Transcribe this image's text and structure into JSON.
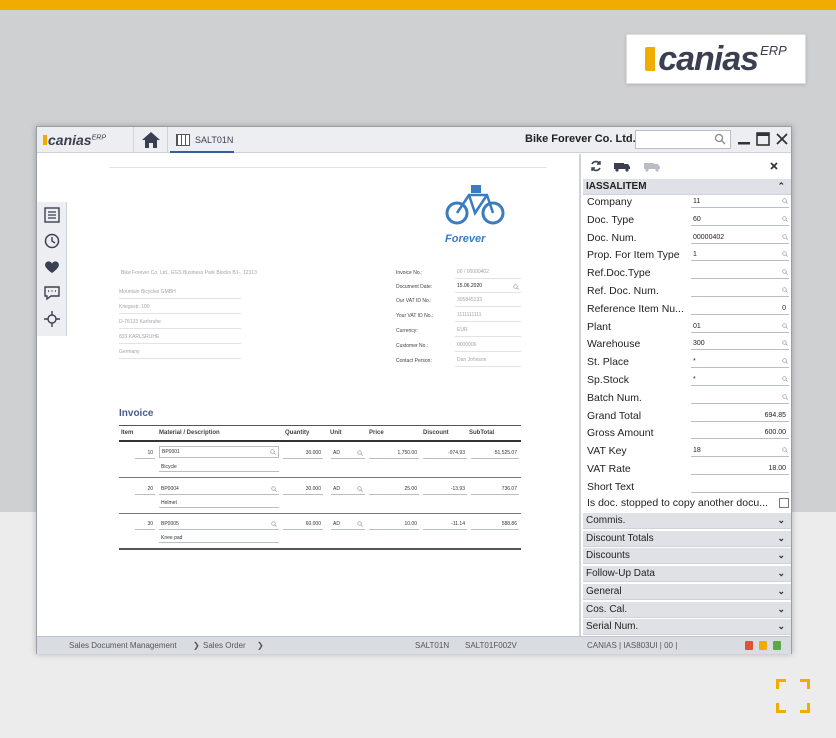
{
  "brand": {
    "name": "canias",
    "suffix": "ERP"
  },
  "window": {
    "app_logo": "canias",
    "app_logo_sup": "ERP",
    "tab_label": "SALT01N",
    "company": "Bike Forever Co. Ltd.",
    "search_placeholder": ""
  },
  "document": {
    "brand_text": "Forever",
    "sender_line": "Bike Forever Co. Ltd., EGS Business Park Blocks B1-, 12313",
    "address": [
      "Mountain Bicycles GMBH",
      "Kriegsstr. 100",
      "D-76133 Karlsruhe",
      "833 KARLSRUHE",
      "Germany"
    ],
    "info": [
      {
        "label": "Invoice No.:",
        "value": "00    /    00000402"
      },
      {
        "label": "Document Date:",
        "value": "15.06.2020"
      },
      {
        "label": "Our VAT ID No.:",
        "value": "305845133"
      },
      {
        "label": "Your VAT ID No.:",
        "value": "1111111111"
      },
      {
        "label": "Currency:",
        "value": "EUR"
      },
      {
        "label": "Customer No.:",
        "value": "0000006"
      },
      {
        "label": "Contact Person:",
        "value": "Dan Johnson"
      }
    ],
    "invoice_title": "Invoice",
    "columns": [
      "Item",
      "Material / Description",
      "Quantity",
      "Unit",
      "Price",
      "Discount",
      "SubTotal"
    ],
    "rows": [
      {
        "item": "10",
        "material": "BP0001",
        "desc": "Bicycle",
        "qty": "30.000",
        "unit": "AD",
        "price": "1,750.00",
        "discount": "-974.93",
        "subtotal": "51,525.07"
      },
      {
        "item": "20",
        "material": "BP0004",
        "desc": "Helmet",
        "qty": "30.000",
        "unit": "AD",
        "price": "25.00",
        "discount": "-13.93",
        "subtotal": "736.07"
      },
      {
        "item": "30",
        "material": "BP0005",
        "desc": "Knee pad",
        "qty": "60.000",
        "unit": "AD",
        "price": "10.00",
        "discount": "-11.14",
        "subtotal": "588.86"
      }
    ]
  },
  "panel": {
    "section": "IASSALITEM",
    "fields": [
      {
        "label": "Company",
        "value": "11",
        "search": true
      },
      {
        "label": "Doc. Type",
        "value": "60",
        "search": true
      },
      {
        "label": "Doc. Num.",
        "value": "00000402",
        "search": true
      },
      {
        "label": "Prop. For Item Type",
        "value": "1",
        "search": true
      },
      {
        "label": "Ref.Doc.Type",
        "value": "",
        "search": true
      },
      {
        "label": "Ref. Doc. Num.",
        "value": "",
        "search": true
      },
      {
        "label": "Reference Item Nu...",
        "value": "0",
        "search": false,
        "right": true
      },
      {
        "label": "Plant",
        "value": "01",
        "search": true
      },
      {
        "label": "Warehouse",
        "value": "300",
        "search": true
      },
      {
        "label": "St. Place",
        "value": "*",
        "search": true
      },
      {
        "label": "Sp.Stock",
        "value": "*",
        "search": true
      },
      {
        "label": "Batch Num.",
        "value": "",
        "search": true
      },
      {
        "label": "Grand Total",
        "value": "694.85",
        "search": false,
        "right": true
      },
      {
        "label": "Gross Amount",
        "value": "600.00",
        "search": false,
        "right": true
      },
      {
        "label": "VAT Key",
        "value": "18",
        "search": true
      },
      {
        "label": "VAT Rate",
        "value": "18.00",
        "search": false,
        "right": true
      },
      {
        "label": "Short Text",
        "value": "",
        "search": false
      }
    ],
    "checkbox_label": "Is doc. stopped to copy another docu...",
    "collapsed_sections": [
      "Commis.",
      "Discount Totals",
      "Discounts",
      "Follow-Up Data",
      "General",
      "Cos. Cal.",
      "Serial Num."
    ]
  },
  "status": {
    "breadcrumb": [
      "Sales Document Management",
      "Sales Order"
    ],
    "code1": "SALT01N",
    "code2": "SALT01F002V",
    "system": "CANIAS | IAS803UI | 00 |"
  },
  "colors": {
    "accent": "#f0ad00",
    "navy": "#3a3f52",
    "link": "#3a5c9c",
    "brand_blue": "#3b7bbf"
  }
}
